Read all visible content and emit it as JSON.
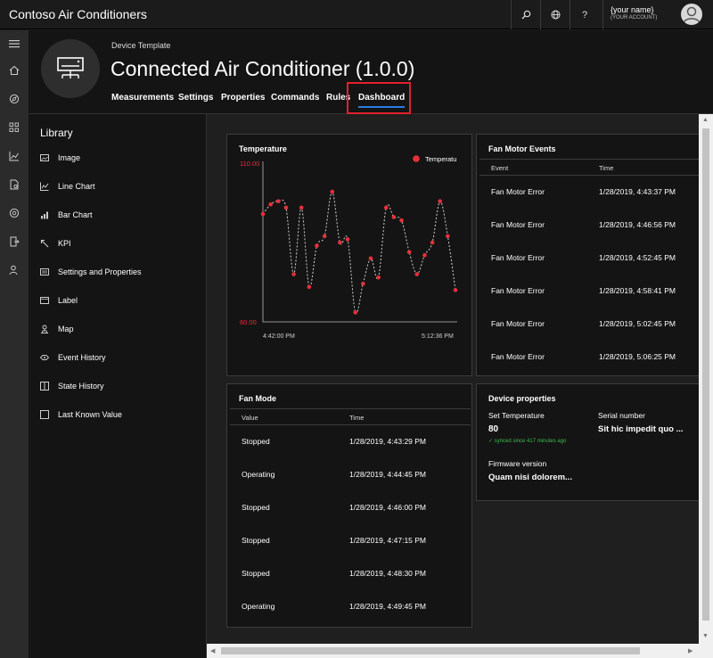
{
  "app": {
    "title": "Contoso Air Conditioners"
  },
  "account": {
    "name": "{your name}",
    "sub": "(YOUR ACCOUNT)"
  },
  "topbar_icons": [
    "search-icon",
    "globe-icon",
    "help-icon"
  ],
  "nav_icons": [
    "hamburger-icon",
    "home-icon",
    "explorer-icon",
    "device-sets-icon",
    "analytics-icon",
    "jobs-icon",
    "device-templates-icon",
    "data-export-icon",
    "administration-icon"
  ],
  "header": {
    "template_label": "Device Template",
    "device_title": "Connected Air Conditioner",
    "version": "(1.0.0)",
    "tabs": [
      {
        "label": "Measurements"
      },
      {
        "label": "Settings"
      },
      {
        "label": "Properties"
      },
      {
        "label": "Commands"
      },
      {
        "label": "Rules"
      },
      {
        "label": "Dashboard",
        "active": true
      }
    ]
  },
  "library": {
    "title": "Library",
    "items": [
      {
        "label": "Image",
        "icon": "image-icon"
      },
      {
        "label": "Line Chart",
        "icon": "line-chart-icon"
      },
      {
        "label": "Bar Chart",
        "icon": "bar-chart-icon"
      },
      {
        "label": "KPI",
        "icon": "kpi-icon"
      },
      {
        "label": "Settings and Properties",
        "icon": "settings-properties-icon"
      },
      {
        "label": "Label",
        "icon": "label-icon"
      },
      {
        "label": "Map",
        "icon": "map-icon"
      },
      {
        "label": "Event History",
        "icon": "event-history-icon"
      },
      {
        "label": "State History",
        "icon": "state-history-icon"
      },
      {
        "label": "Last Known Value",
        "icon": "last-known-value-icon"
      }
    ]
  },
  "temperature_card": {
    "title": "Temperature",
    "legend": "Temperatu",
    "y_max_label": "110.00",
    "y_min_label": "60.00",
    "x_start_label": "4:42:00 PM",
    "x_end_label": "5:12:36 PM"
  },
  "chart_data": {
    "type": "line",
    "title": "Temperature",
    "ylim": [
      60,
      110
    ],
    "x_range": [
      "4:42:00 PM",
      "5:12:36 PM"
    ],
    "series": [
      {
        "name": "Temperatu",
        "color": "#e8303a",
        "values": [
          94,
          97,
          98,
          96,
          75,
          96,
          71,
          84,
          87,
          101,
          85,
          86,
          63,
          72,
          80,
          74,
          96,
          93,
          92,
          82,
          75,
          81,
          85,
          98,
          87,
          70
        ]
      }
    ],
    "grid": false,
    "legend": "top-right"
  },
  "fan_motor_events": {
    "title": "Fan Motor Events",
    "columns": [
      "Event",
      "Time"
    ],
    "rows": [
      {
        "event": "Fan Motor Error",
        "time": "1/28/2019, 4:43:37 PM"
      },
      {
        "event": "Fan Motor Error",
        "time": "1/28/2019, 4:46:56 PM"
      },
      {
        "event": "Fan Motor Error",
        "time": "1/28/2019, 4:52:45 PM"
      },
      {
        "event": "Fan Motor Error",
        "time": "1/28/2019, 4:58:41 PM"
      },
      {
        "event": "Fan Motor Error",
        "time": "1/28/2019, 5:02:45 PM"
      },
      {
        "event": "Fan Motor Error",
        "time": "1/28/2019, 5:06:25 PM"
      }
    ]
  },
  "fan_mode": {
    "title": "Fan Mode",
    "columns": [
      "Value",
      "Time"
    ],
    "rows": [
      {
        "value": "Stopped",
        "time": "1/28/2019, 4:43:29 PM"
      },
      {
        "value": "Operating",
        "time": "1/28/2019, 4:44:45 PM"
      },
      {
        "value": "Stopped",
        "time": "1/28/2019, 4:46:00 PM"
      },
      {
        "value": "Stopped",
        "time": "1/28/2019, 4:47:15 PM"
      },
      {
        "value": "Stopped",
        "time": "1/28/2019, 4:48:30 PM"
      },
      {
        "value": "Operating",
        "time": "1/28/2019, 4:49:45 PM"
      }
    ]
  },
  "device_properties": {
    "title": "Device properties",
    "set_temperature_label": "Set Temperature",
    "set_temperature_value": "80",
    "synced_text": "✓ synced since 417 minutes ago",
    "serial_label": "Serial number",
    "serial_value": "Sit hic impedit quo ...",
    "firmware_label": "Firmware version",
    "firmware_value": "Quam nisi dolorem..."
  },
  "colors": {
    "accent": "#2a7de1",
    "highlight": "#e0202c",
    "series": "#e8303a",
    "synced": "#3fb950"
  }
}
